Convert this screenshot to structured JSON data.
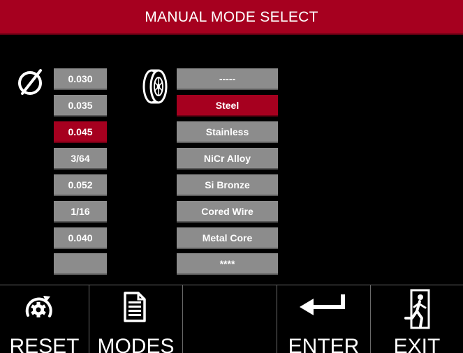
{
  "header": {
    "title": "MANUAL MODE SELECT"
  },
  "diameter": {
    "icon": "diameter-icon",
    "items": [
      "0.030",
      "0.035",
      "0.045",
      "3/64",
      "0.052",
      "1/16",
      "0.040",
      ""
    ],
    "selected_index": 2
  },
  "material": {
    "icon": "wire-spool-icon",
    "items": [
      "-----",
      "Steel",
      "Stainless",
      "NiCr Alloy",
      "Si Bronze",
      "Cored Wire",
      "Metal Core",
      "****"
    ],
    "selected_index": 1
  },
  "footer": {
    "reset": {
      "label": "RESET",
      "icon": "reset-gear-icon"
    },
    "modes": {
      "label": "MODES",
      "icon": "document-icon"
    },
    "blank": {
      "label": ""
    },
    "enter": {
      "label": "ENTER",
      "icon": "enter-arrow-icon"
    },
    "exit": {
      "label": "EXIT",
      "icon": "exit-door-icon"
    }
  },
  "colors": {
    "accent": "#a6001f",
    "button": "#8c8c8c",
    "background": "#000000"
  }
}
